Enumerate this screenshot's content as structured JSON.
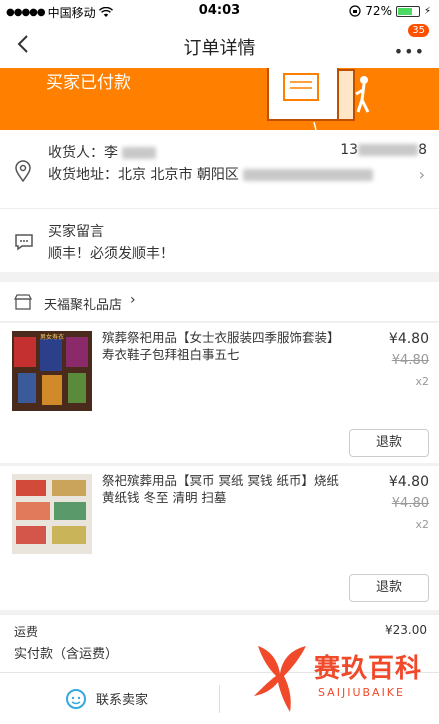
{
  "status_bar": {
    "carrier": "中国移动",
    "time": "04:03",
    "battery": "72%",
    "battery_level": 0.72
  },
  "nav": {
    "title": "订单详情",
    "badge": "35"
  },
  "banner": {
    "status_text": "买家已付款"
  },
  "address": {
    "recipient_label": "收货人：李",
    "phone_prefix": "13",
    "phone_suffix": "8",
    "address_label": "收货地址：北京 北京市 朝阳区"
  },
  "message": {
    "label": "买家留言",
    "content": "顺丰！必须发顺丰！"
  },
  "shop": {
    "name": "天福聚礼品店"
  },
  "items": [
    {
      "name": "殡葬祭祀用品【女士衣服装四季服饰套装】寿衣鞋子包拜祖白事五七",
      "price": "¥4.80",
      "original_price": "¥4.80",
      "quantity": "x2",
      "refund_label": "退款"
    },
    {
      "name": "祭祀殡葬用品【冥币 冥纸 冥钱 纸币】烧纸黄纸钱 冬至 清明 扫墓",
      "price": "¥4.80",
      "original_price": "¥4.80",
      "quantity": "x2",
      "refund_label": "退款"
    }
  ],
  "fees": {
    "shipping_label": "运费",
    "shipping_value": "¥23.00",
    "paid_label": "实付款（含运费）"
  },
  "bottom": {
    "contact_label": "联系卖家"
  },
  "watermark": {
    "text": "赛玖百科",
    "sub": "SAIJIUBAIKE"
  },
  "colors": {
    "accent": "#ff8000",
    "badge": "#ff5000",
    "watermark": "#f04a2a"
  }
}
